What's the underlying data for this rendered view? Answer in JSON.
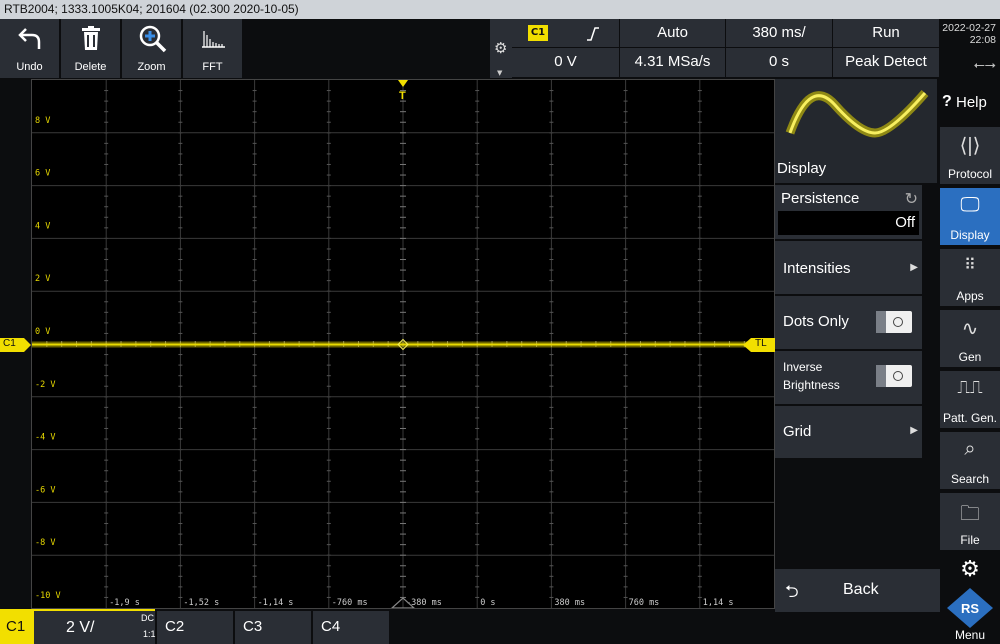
{
  "title_bar": "RTB2004; 1333.1005K04; 201604 (02.300 2020-10-05)",
  "toolbar": {
    "undo": "Undo",
    "delete": "Delete",
    "zoom": "Zoom",
    "fft": "FFT"
  },
  "header": {
    "trigger_channel": "C1",
    "trigger_slope_icon": "rising-edge-icon",
    "trigger_mode": "Auto",
    "timebase": "380 ms/",
    "run_state": "Run",
    "trigger_level": "0 V",
    "sample_rate": "4.31 MSa/s",
    "time_offset": "0 s",
    "acq_mode": "Peak Detect"
  },
  "datetime": {
    "date": "2022-02-27",
    "time": "22:08"
  },
  "plot": {
    "y_labels": [
      "8 V",
      "6 V",
      "4 V",
      "2 V",
      "0 V",
      "-2 V",
      "-4 V",
      "-6 V",
      "-8 V",
      "-10 V"
    ],
    "x_labels": [
      "-1,9 s",
      "-1,52 s",
      "-1,14 s",
      "-760 ms",
      "-380 ms",
      "0 s",
      "380 ms",
      "760 ms",
      "1,14 s"
    ],
    "channel_marker": "C1",
    "trigger_level_marker": "TL",
    "trigger_position_marker": "T",
    "trace_color": "#e8d900"
  },
  "side_panel": {
    "preview_label": "Display",
    "persistence_label": "Persistence",
    "persistence_value": "Off",
    "intensities": "Intensities",
    "dots_only": "Dots Only",
    "inverse_brightness_line1": "Inverse",
    "inverse_brightness_line2": "Brightness",
    "grid": "Grid",
    "back": "Back"
  },
  "right_rail": {
    "help": "Help",
    "protocol": "Protocol",
    "display": "Display",
    "apps": "Apps",
    "gen": "Gen",
    "patt_gen": "Patt. Gen.",
    "search": "Search",
    "file": "File",
    "menu": "Menu"
  },
  "bottom": {
    "c1_label": "C1",
    "c1_scale": "2 V/",
    "c1_coupling": "DC",
    "c1_probe": "1:1",
    "c2_label": "C2",
    "c3_label": "C3",
    "c4_label": "C4"
  },
  "colors": {
    "channel1": "#f2df00",
    "active_blue": "#2b6fc0",
    "panel": "#2a2e35"
  }
}
